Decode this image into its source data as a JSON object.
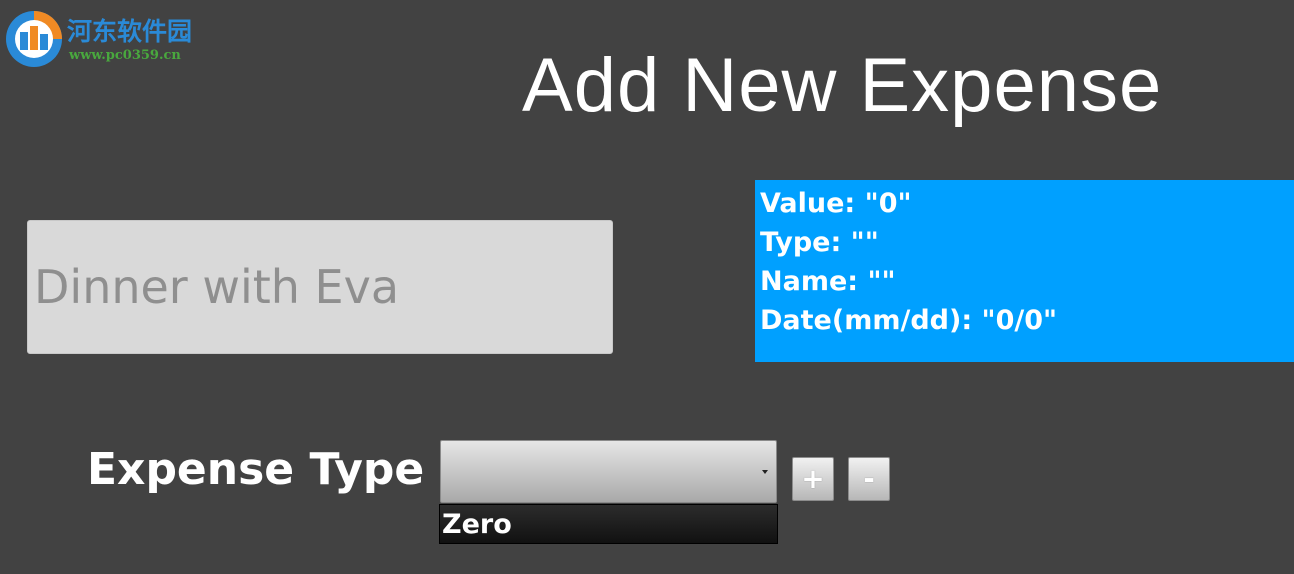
{
  "watermark": {
    "title": "河东软件园",
    "url": "www.pc0359.cn",
    "icon": "logo-mark-icon"
  },
  "page": {
    "title": "Add New Expense"
  },
  "name_field": {
    "placeholder": "Dinner with Eva",
    "value": ""
  },
  "info_panel": {
    "lines": [
      "Value: \"0\"",
      "Type: \"\"",
      "Name: \"\"",
      "Date(mm/dd): \"0/0\""
    ]
  },
  "expense_type": {
    "label": "Expense Type",
    "selected": "",
    "options": [
      "Zero"
    ],
    "add_label": "+",
    "remove_label": "-"
  },
  "colors": {
    "background": "#424242",
    "info_panel": "#00a0ff",
    "field": "#d9d9d9"
  }
}
